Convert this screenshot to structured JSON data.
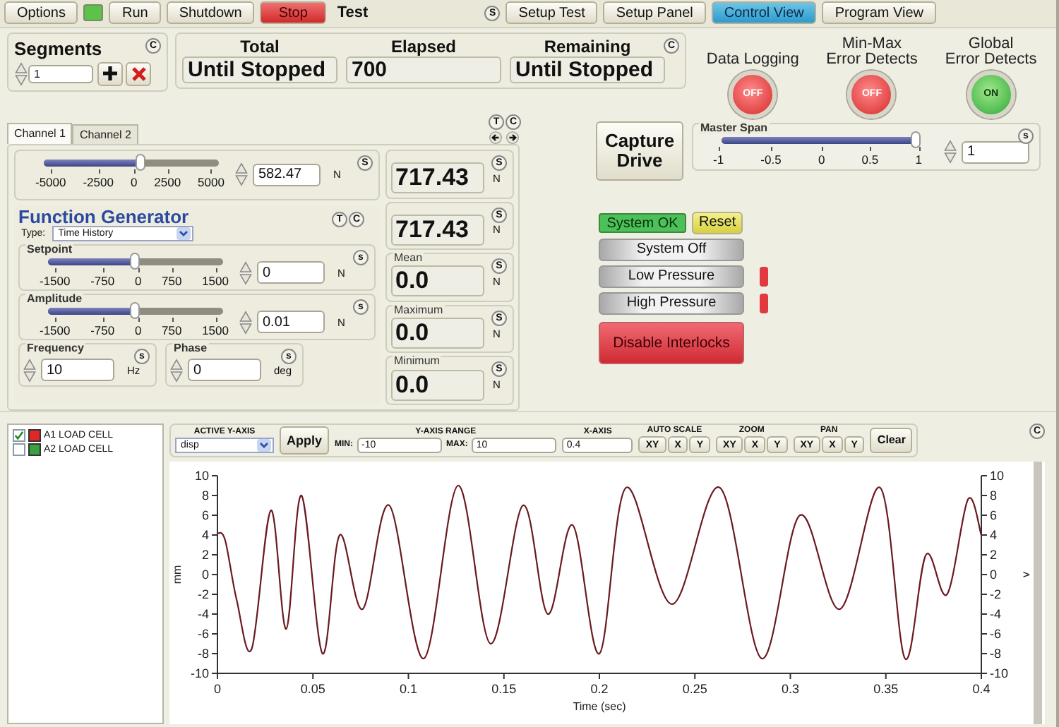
{
  "toolbar": {
    "items": [
      {
        "kind": "button",
        "label": "Options"
      },
      {
        "kind": "led",
        "on": true
      },
      {
        "kind": "button",
        "label": "Run"
      },
      {
        "kind": "button",
        "label": "Shutdown"
      },
      {
        "kind": "danger",
        "label": "Stop"
      },
      {
        "kind": "label",
        "label": "Test"
      }
    ],
    "corner": "S",
    "views": [
      {
        "label": "Setup Test",
        "selected": false
      },
      {
        "label": "Setup Panel",
        "selected": false
      },
      {
        "label": "Control View",
        "selected": true
      },
      {
        "label": "Program View",
        "selected": false
      }
    ]
  },
  "segments": {
    "title": "Segments",
    "corner": "C",
    "value": "1"
  },
  "counts": {
    "corner": "C",
    "items": [
      {
        "label": "Total",
        "value": "Until Stopped"
      },
      {
        "label": "Elapsed",
        "value": "700"
      },
      {
        "label": "Remaining",
        "value": "Until Stopped"
      }
    ]
  },
  "indicators": [
    {
      "label_lines": [
        "Data Logging"
      ],
      "on": false,
      "text": "OFF"
    },
    {
      "label_lines": [
        "Min-Max",
        "Error Detects"
      ],
      "on": false,
      "text": "OFF"
    },
    {
      "label_lines": [
        "Global",
        "Error Detects"
      ],
      "on": true,
      "text": "ON"
    }
  ],
  "channel_tabs": [
    {
      "label": "Channel 1",
      "selected": true
    },
    {
      "label": "Channel 2",
      "selected": false
    }
  ],
  "channel_corners": [
    "T",
    "C"
  ],
  "command": {
    "corner": "S",
    "ticks": [
      "-5000",
      "-2500",
      "0",
      "2500",
      "5000"
    ],
    "level": 0.56,
    "value": "582.47",
    "unit": "N"
  },
  "function_generator": {
    "title": "Function Generator",
    "corners": [
      "T",
      "C"
    ],
    "type_label": "Type:",
    "type_value": "Time History",
    "setpoint": {
      "label": "Setpoint",
      "corner": "s",
      "ticks": [
        "-1500",
        "-750",
        "0",
        "750",
        "1500"
      ],
      "level": 0.5,
      "value": "0",
      "unit": "N"
    },
    "amplitude": {
      "label": "Amplitude",
      "corner": "s",
      "ticks": [
        "-1500",
        "-750",
        "0",
        "750",
        "1500"
      ],
      "level": 0.5,
      "value": "0.01",
      "unit": "N"
    },
    "frequency": {
      "label": "Frequency",
      "corner": "s",
      "value": "10",
      "unit": "Hz"
    },
    "phase": {
      "label": "Phase",
      "corner": "s",
      "value": "0",
      "unit": "deg"
    }
  },
  "readouts": [
    {
      "corner": "S",
      "value": "717.43",
      "unit": "N"
    },
    {
      "corner": "S",
      "value": "717.43",
      "unit": "N"
    },
    {
      "label": "Mean",
      "corner": "S",
      "value": "0.0",
      "unit": "N"
    },
    {
      "label": "Maximum",
      "corner": "S",
      "value": "0.0",
      "unit": "N"
    },
    {
      "label": "Minimum",
      "corner": "S",
      "value": "0.0",
      "unit": "N"
    }
  ],
  "capture": {
    "label": "Capture Drive"
  },
  "master_span": {
    "label": "Master Span",
    "corner": "s",
    "ticks": [
      "-1",
      "-0.5",
      "0",
      "0.5",
      "1"
    ],
    "level": 1,
    "value": "1"
  },
  "system": {
    "status": {
      "label": "System OK",
      "ok": true
    },
    "reset": "Reset",
    "interlocks": [
      {
        "kind": "plain",
        "label": "System Off"
      },
      {
        "kind": "alarm",
        "label": "Low Pressure",
        "tripped": true
      },
      {
        "kind": "alarm",
        "label": "High Pressure",
        "tripped": true
      }
    ],
    "disable": "Disable Interlocks"
  },
  "channels": [
    {
      "label": "A1 LOAD CELL",
      "checked": true,
      "color": "#e02828"
    },
    {
      "label": "A2 LOAD CELL",
      "checked": false,
      "color": "#3aa040"
    }
  ],
  "plot": {
    "corner": "C",
    "active_y_axis": {
      "label": "ACTIVE Y-AXIS",
      "value": "disp",
      "apply": "Apply"
    },
    "y_range": {
      "label": "Y-AXIS RANGE",
      "min_label": "MIN:",
      "min": "-10",
      "max_label": "MAX:",
      "max": "10"
    },
    "x_axis": {
      "label": "X-AXIS",
      "value": "0.4"
    },
    "groups": [
      {
        "label": "AUTO SCALE",
        "buttons": [
          "XY",
          "X",
          "Y"
        ]
      },
      {
        "label": "ZOOM",
        "buttons": [
          "XY",
          "X",
          "Y"
        ]
      },
      {
        "label": "PAN",
        "buttons": [
          "XY",
          "X",
          "Y"
        ]
      }
    ],
    "clear": "Clear",
    "right_axis": {
      "label": "v",
      "ticks": [
        "10",
        "8",
        "6",
        "4",
        "2",
        "0",
        "-2",
        "-4",
        "-6",
        "-8",
        "-10"
      ]
    },
    "chart_data": {
      "type": "line",
      "xlabel": "Time (sec)",
      "ylabel": "mm",
      "xlim": [
        0,
        0.4
      ],
      "ylim": [
        -10,
        10
      ],
      "xticks": [
        0,
        0.05,
        0.1,
        0.15,
        0.2,
        0.25,
        0.3,
        0.35,
        0.4
      ],
      "yticks": [
        -10,
        -8,
        -6,
        -4,
        -2,
        0,
        2,
        4,
        6,
        8,
        10
      ],
      "x": [
        0,
        0.004,
        0.01,
        0.018,
        0.028,
        0.036,
        0.044,
        0.055,
        0.064,
        0.076,
        0.09,
        0.108,
        0.126,
        0.143,
        0.16,
        0.173,
        0.186,
        0.2,
        0.214,
        0.238,
        0.263,
        0.285,
        0.305,
        0.326,
        0.347,
        0.36,
        0.371,
        0.382,
        0.393,
        0.4
      ],
      "series": [
        {
          "color": "#6a1a20",
          "values": [
            4.2,
            3.5,
            -2.5,
            -7.5,
            6.5,
            -5.5,
            8,
            -8,
            4,
            -3.5,
            7,
            -8.5,
            9,
            -7,
            7,
            -4,
            5,
            -8,
            8.8,
            -3,
            8.8,
            -8.5,
            6,
            -3.5,
            8.8,
            -8.5,
            2,
            -2,
            7.6,
            4
          ]
        }
      ]
    }
  }
}
